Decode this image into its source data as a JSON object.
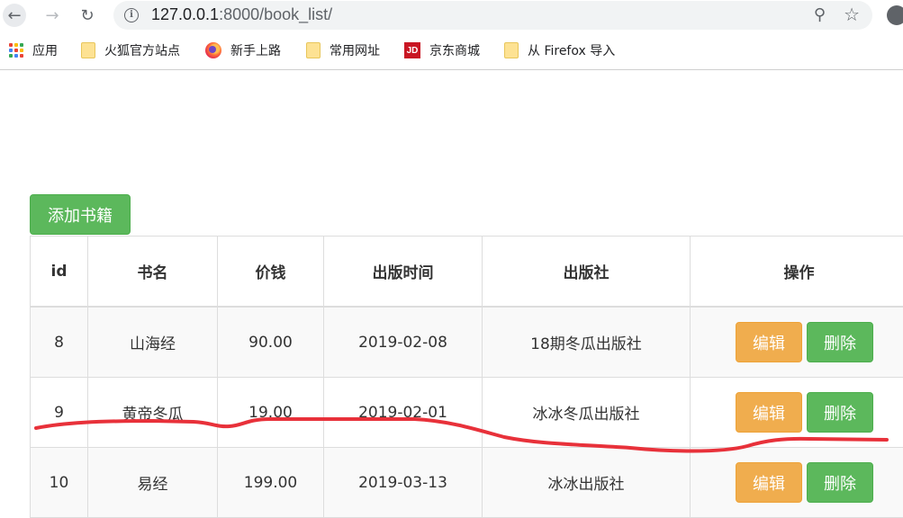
{
  "browser": {
    "url_host": "127.0.0.1",
    "url_rest": ":8000/book_list/"
  },
  "bookmarks": [
    {
      "label": "应用",
      "icon": "apps-grid-icon"
    },
    {
      "label": "火狐官方站点",
      "icon": "folder-icon"
    },
    {
      "label": "新手上路",
      "icon": "firefox-icon"
    },
    {
      "label": "常用网址",
      "icon": "folder-icon"
    },
    {
      "label": "京东商城",
      "icon": "jd-icon"
    },
    {
      "label": "从 Firefox 导入",
      "icon": "folder-icon"
    }
  ],
  "jd_icon_text": "JD",
  "page": {
    "add_button": "添加书籍",
    "columns": [
      "id",
      "书名",
      "价钱",
      "出版时间",
      "出版社",
      "操作"
    ],
    "rows": [
      {
        "id": "8",
        "title": "山海经",
        "price": "90.00",
        "date": "2019-02-08",
        "publisher": "18期冬瓜出版社"
      },
      {
        "id": "9",
        "title": "黄帝冬瓜",
        "price": "19.00",
        "date": "2019-02-01",
        "publisher": "冰冰冬瓜出版社"
      },
      {
        "id": "10",
        "title": "易经",
        "price": "199.00",
        "date": "2019-03-13",
        "publisher": "冰冰出版社"
      }
    ],
    "edit_label": "编辑",
    "delete_label": "删除"
  },
  "colors": {
    "success": "#5cb85c",
    "warning": "#f0ad4e",
    "annotation": "#e8313a"
  }
}
